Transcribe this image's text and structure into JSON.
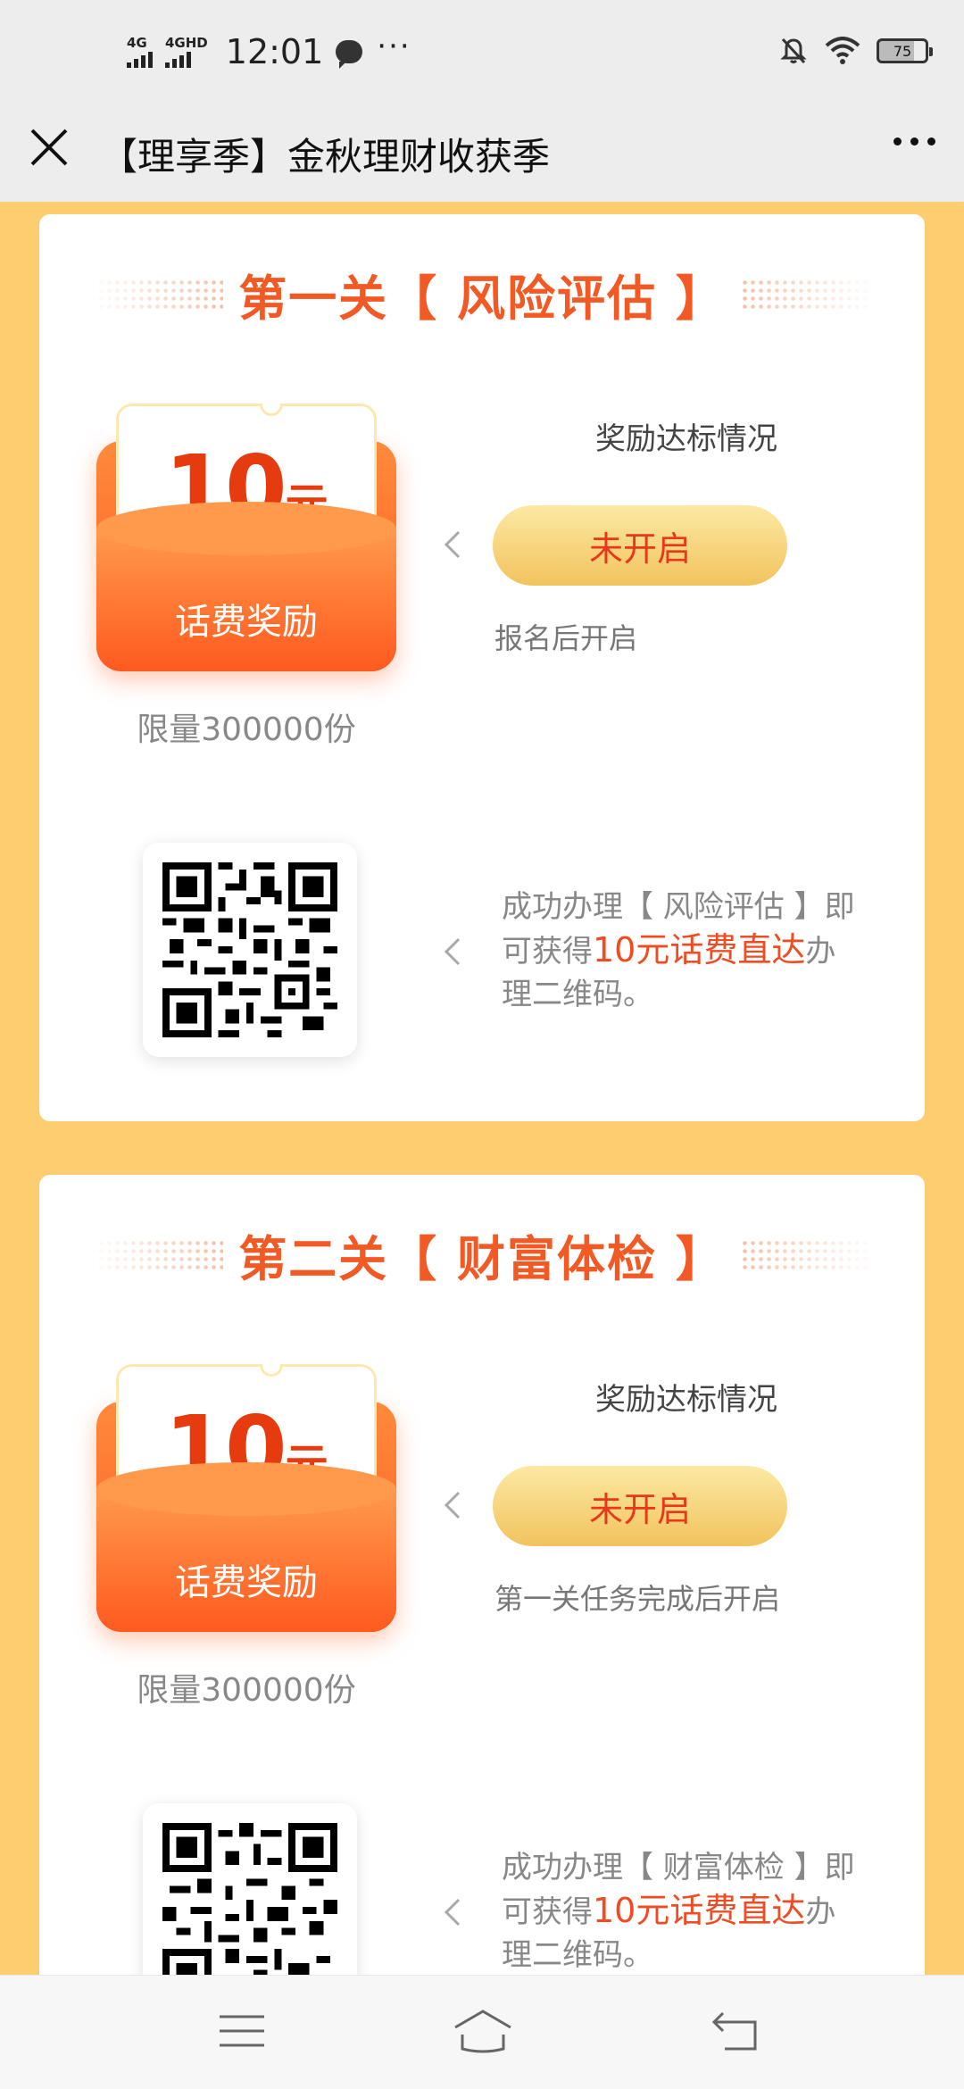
{
  "status_bar": {
    "sim1": "4G",
    "sim2": "4GHD",
    "time": "12:01",
    "battery": "75"
  },
  "title_bar": {
    "title": "【理享季】金秋理财收获季"
  },
  "levels": [
    {
      "heading": "第一关【 风险评估 】",
      "reward_amount": "10",
      "reward_unit": "元",
      "reward_label": "话费奖励",
      "limit": "限量300000份",
      "status_title": "奖励达标情况",
      "status_button": "未开启",
      "status_note": "报名后开启",
      "qr_desc_prefix": "成功办理【 风险评估 】即可获得",
      "qr_desc_highlight": "10元话费直达",
      "qr_desc_suffix": "办理二维码。"
    },
    {
      "heading": "第二关【 财富体检 】",
      "reward_amount": "10",
      "reward_unit": "元",
      "reward_label": "话费奖励",
      "limit": "限量300000份",
      "status_title": "奖励达标情况",
      "status_button": "未开启",
      "status_note": "第一关任务完成后开启",
      "qr_desc_prefix": "成功办理【 财富体检 】即可获得",
      "qr_desc_highlight": "10元话费直达",
      "qr_desc_suffix": "办理二维码。"
    }
  ],
  "colors": {
    "background": "#fdce6f",
    "accent": "#f15a24",
    "button_text": "#e8371b"
  }
}
